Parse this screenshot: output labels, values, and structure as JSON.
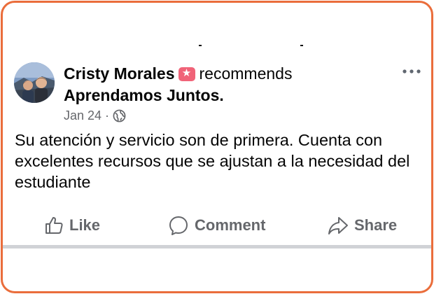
{
  "post": {
    "author": "Cristy Morales",
    "badge_icon": "recommend-star-icon",
    "action_text": "recommends",
    "page_name": "Aprendamos Juntos",
    "page_suffix": ".",
    "date": "Jan 24",
    "separator": "·",
    "audience_icon": "globe-icon",
    "more_icon": "more-options-icon",
    "text": "Su atención y servicio son de primera. Cuenta con excelentes recursos que se ajustan a la necesidad del estudiante"
  },
  "actions": {
    "like_label": "Like",
    "comment_label": "Comment",
    "share_label": "Share"
  },
  "colors": {
    "frame_border": "#ea6d3b",
    "badge": "#f06378",
    "secondary_text": "#65676b"
  }
}
